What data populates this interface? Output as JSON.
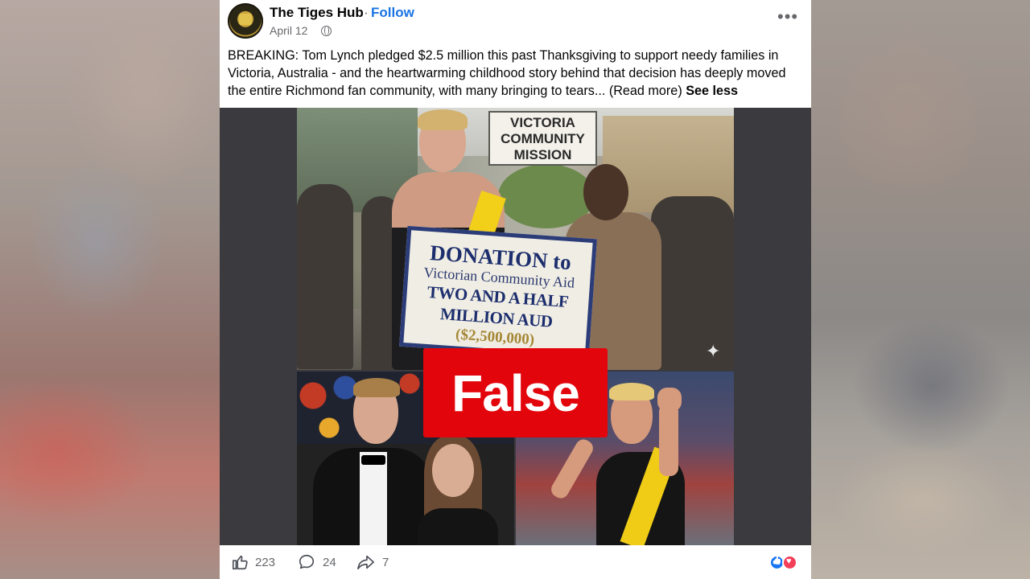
{
  "post": {
    "page_name": "The Tiges Hub",
    "separator": "·",
    "follow_label": "Follow",
    "date": "April 12",
    "more_icon": "more-horizontal-icon",
    "privacy_icon": "globe-icon",
    "caption": "BREAKING: Tom Lynch pledged $2.5 million this past Thanksgiving to support needy families in Victoria, Australia - and the heartwarming childhood story behind that decision has deeply moved the entire Richmond fan community, with many bringing to tears... (Read more)",
    "see_less_label": "See less"
  },
  "media": {
    "mission_sign": [
      "VICTORIA",
      "COMMUNITY",
      "MISSION"
    ],
    "donation_sign": {
      "line1": "DONATION to",
      "line2": "Victorian Community Aid",
      "line3": "TWO AND A HALF MILLION AUD",
      "line4": "($2,500,000)"
    },
    "verdict": "False",
    "verdict_color": "#e3050c"
  },
  "footer": {
    "like_icon": "thumbs-up-icon",
    "like_count": "223",
    "comment_icon": "comment-bubble-icon",
    "comment_count": "24",
    "share_icon": "share-arrow-icon",
    "share_count": "7",
    "reaction_icons": [
      "like-reaction-icon",
      "love-reaction-icon"
    ]
  },
  "colors": {
    "accent": "#1b74e4",
    "text_secondary": "#65676b",
    "media_background": "#3b3a3f"
  }
}
